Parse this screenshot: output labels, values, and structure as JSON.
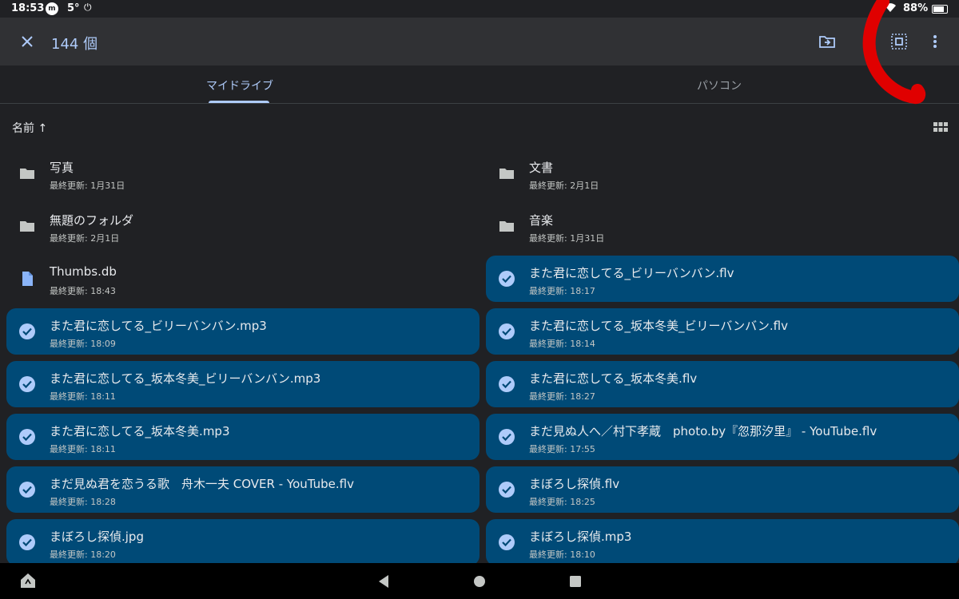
{
  "status": {
    "time": "18:53",
    "app_badge": "m",
    "temp": "5°",
    "battery": "88%"
  },
  "appbar": {
    "count_label": "144 個"
  },
  "tabs": [
    {
      "label": "マイドライブ"
    },
    {
      "label": "パソコン"
    }
  ],
  "sort": {
    "label": "名前 ↑"
  },
  "items": [
    {
      "name": "写真",
      "meta": "最終更新: 1月31日",
      "type": "folder",
      "selected": false
    },
    {
      "name": "文書",
      "meta": "最終更新: 2月1日",
      "type": "folder",
      "selected": false
    },
    {
      "name": "無題のフォルダ",
      "meta": "最終更新: 2月1日",
      "type": "folder",
      "selected": false
    },
    {
      "name": "音楽",
      "meta": "最終更新: 1月31日",
      "type": "folder",
      "selected": false
    },
    {
      "name": "Thumbs.db",
      "meta": "最終更新: 18:43",
      "type": "file",
      "selected": false
    },
    {
      "name": "また君に恋してる_ビリーバンバン.flv",
      "meta": "最終更新: 18:17",
      "type": "file",
      "selected": true
    },
    {
      "name": "また君に恋してる_ビリーバンバン.mp3",
      "meta": "最終更新: 18:09",
      "type": "file",
      "selected": true
    },
    {
      "name": "また君に恋してる_坂本冬美_ビリーバンバン.flv",
      "meta": "最終更新: 18:14",
      "type": "file",
      "selected": true
    },
    {
      "name": "また君に恋してる_坂本冬美_ビリーバンバン.mp3",
      "meta": "最終更新: 18:11",
      "type": "file",
      "selected": true
    },
    {
      "name": "また君に恋してる_坂本冬美.flv",
      "meta": "最終更新: 18:27",
      "type": "file",
      "selected": true
    },
    {
      "name": "また君に恋してる_坂本冬美.mp3",
      "meta": "最終更新: 18:11",
      "type": "file",
      "selected": true
    },
    {
      "name": "まだ見ぬ人へ／村下孝蔵　photo.by『忽那汐里』 - YouTube.flv",
      "meta": "最終更新: 17:55",
      "type": "file",
      "selected": true
    },
    {
      "name": "まだ見ぬ君を恋うる歌　舟木一夫 COVER - YouTube.flv",
      "meta": "最終更新: 18:28",
      "type": "file",
      "selected": true
    },
    {
      "name": "まぼろし探偵.flv",
      "meta": "最終更新: 18:25",
      "type": "file",
      "selected": true
    },
    {
      "name": "まぼろし探偵.jpg",
      "meta": "最終更新: 18:20",
      "type": "file",
      "selected": true
    },
    {
      "name": "まぼろし探偵.mp3",
      "meta": "最終更新: 18:10",
      "type": "file",
      "selected": true
    }
  ],
  "colors": {
    "selected_bg": "#004a77",
    "accent": "#aecbfa",
    "annotation": "#e00000"
  }
}
